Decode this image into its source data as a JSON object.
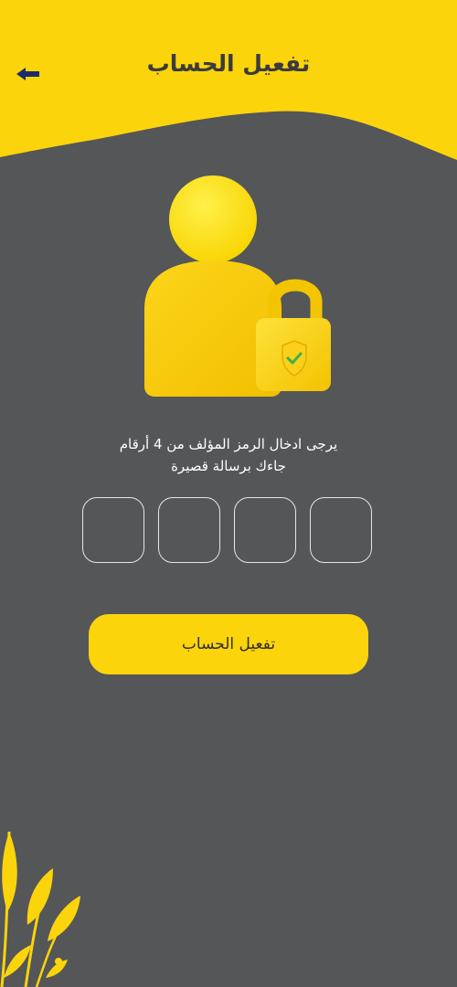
{
  "header": {
    "title": "تفعيل الحساب",
    "back_icon": "arrow-left-icon"
  },
  "colors": {
    "background": "#545658",
    "accent": "#fcd40b",
    "title_text": "#3b3b3d",
    "back_icon": "#1f2a6e",
    "shield": "#fbcf1a",
    "check": "#3fae49"
  },
  "illustration": {
    "icons": [
      "user-avatar-icon",
      "padlock-icon",
      "shield-check-icon"
    ]
  },
  "instruction": {
    "line1": "يرجى ادخال الرمز المؤلف من 4 أرقام",
    "line2": "جاءك برسالة قصيرة"
  },
  "otp": {
    "digits": [
      "",
      "",
      "",
      ""
    ]
  },
  "actions": {
    "activate_label": "تفعيل الحساب"
  },
  "decoration": {
    "icon": "leaves-icon"
  }
}
